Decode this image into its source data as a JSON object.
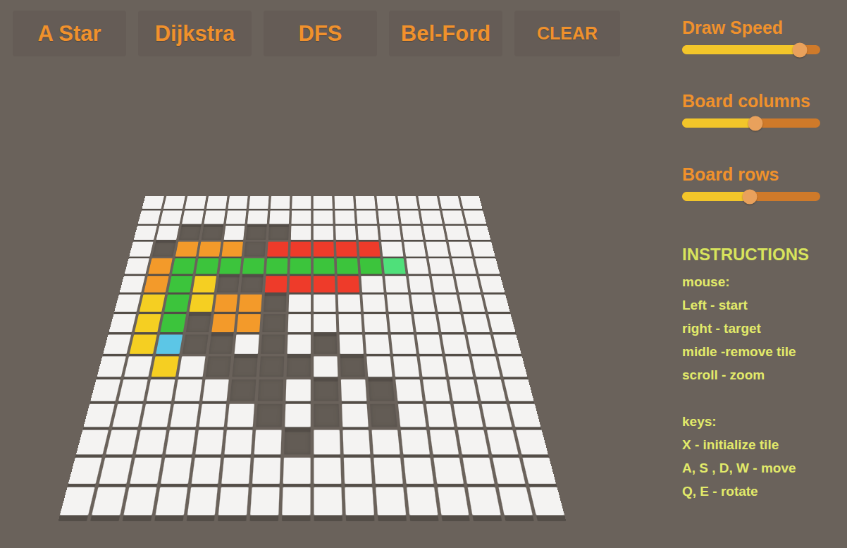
{
  "toolbar": {
    "buttons": [
      {
        "label": "A Star",
        "kind": "algorithm"
      },
      {
        "label": "Dijkstra",
        "kind": "algorithm"
      },
      {
        "label": "DFS",
        "kind": "algorithm"
      },
      {
        "label": "Bel-Ford",
        "kind": "algorithm"
      },
      {
        "label": "CLEAR",
        "kind": "action"
      }
    ]
  },
  "sliders": [
    {
      "label": "Draw Speed",
      "level": 0.85
    },
    {
      "label": "Board columns",
      "level": 0.53
    },
    {
      "label": "Board rows",
      "level": 0.49
    }
  ],
  "instructions": {
    "title": "INSTRUCTIONS",
    "groups": [
      {
        "heading": "mouse:",
        "lines": [
          "Left - start",
          "right - target",
          "midle -remove tile",
          "scroll - zoom"
        ]
      },
      {
        "heading": "keys:",
        "lines": [
          "X - initialize tile",
          "A, S , D, W - move",
          "Q, E - rotate"
        ]
      }
    ]
  },
  "board": {
    "cell_kinds": {
      "w": {
        "name": "tile",
        "color": "#f4f3f2"
      },
      "h": {
        "name": "removed",
        "color": "#5d5650"
      },
      "g": {
        "name": "path",
        "color": "#3cc43c"
      },
      "r": {
        "name": "visited",
        "color": "#ee3b2a"
      },
      "O": {
        "name": "frontier",
        "color": "#f39a2a"
      },
      "Y": {
        "name": "searched",
        "color": "#f5cf22"
      },
      "b": {
        "name": "start",
        "color": "#5cc6e6"
      },
      "G": {
        "name": "target",
        "color": "#4fe07a"
      }
    },
    "rows": [
      "wwwwwwwwwwwwwwww",
      "wwwwwwwwwwwwwwww",
      "wwhhwhhwwwwwwwww",
      "whOOOhrrrrrwwwww",
      "wOgggggggggGwwww",
      "wOgYhhrrrrwwwwww",
      "wYgYOOhwwwwwwwww",
      "wYghOOhwwwwwwwww",
      "wYbhhwhwhwwwwwww",
      "wwYwhhhhwhwwwwww",
      "wwwwwhhwhwhwwwww",
      "wwwwwwhwhwhwwwww",
      "wwwwwwwhwwwwwwww",
      "wwwwwwwwwwwwwwww",
      "wwwwwwwwwwwwwwww"
    ]
  }
}
